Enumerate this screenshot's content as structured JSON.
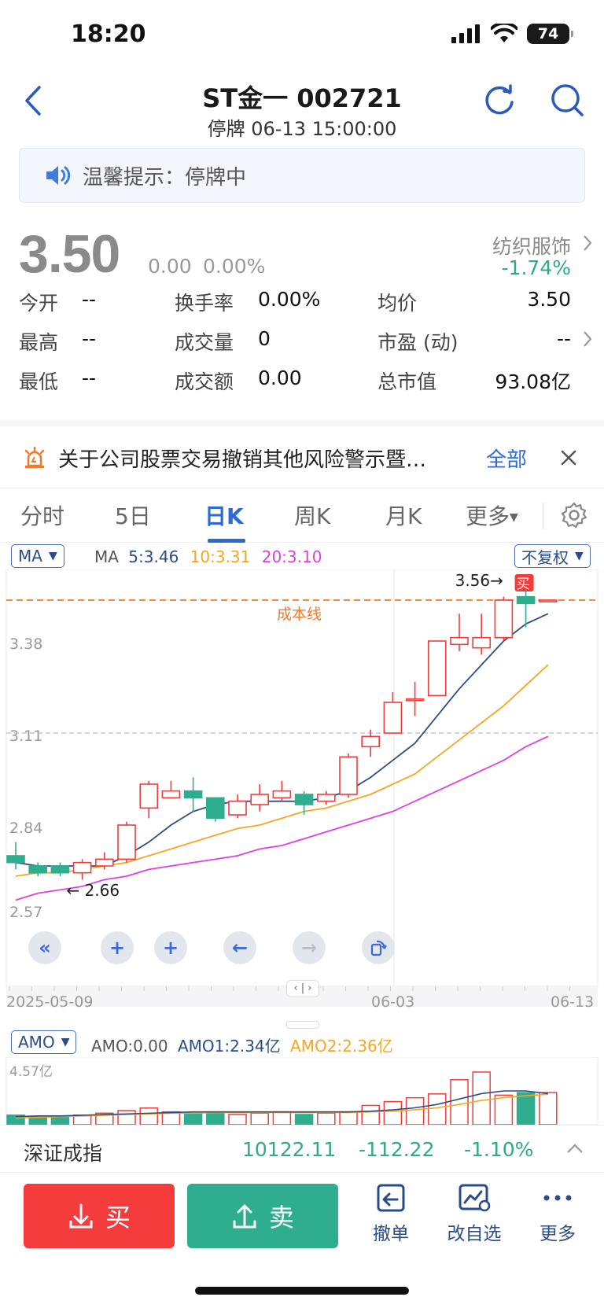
{
  "status_bar": {
    "time": "18:20",
    "battery": "74"
  },
  "header": {
    "title": "ST金一 002721",
    "subtitle": "停牌 06-13 15:00:00"
  },
  "notice": {
    "text": "温馨提示：停牌中"
  },
  "quote": {
    "price": "3.50",
    "change": "0.00",
    "change_pct": "0.00%",
    "sector": "纺织服饰",
    "sector_change": "-1.74%"
  },
  "stats": {
    "open_label": "今开",
    "open": "--",
    "high_label": "最高",
    "high": "--",
    "low_label": "最低",
    "low": "--",
    "turnover_label": "换手率",
    "turnover": "0.00%",
    "volume_label": "成交量",
    "volume": "0",
    "amount_label": "成交额",
    "amount": "0.00",
    "avg_label": "均价",
    "avg": "3.50",
    "pe_label": "市盈 (动)",
    "pe": "--",
    "mcap_label": "总市值",
    "mcap": "93.08亿"
  },
  "announcement": {
    "text": "关于公司股票交易撤销其他风险警示暨…",
    "all": "全部"
  },
  "tabs": [
    "分时",
    "5日",
    "日K",
    "周K",
    "月K",
    "更多"
  ],
  "chart_controls": {
    "ma_dropdown": "MA",
    "ma_title": "MA",
    "ma5": "5:3.46",
    "ma10": "10:3.31",
    "ma20": "20:3.10",
    "adjust_dropdown": "不复权",
    "cost_line": "成本线",
    "buy_marker": "买",
    "high_label": "3.56",
    "low_label": "2.66"
  },
  "colors": {
    "up": "#f23c3c",
    "down": "#2fae8f",
    "ma5": "#2a4d8a",
    "ma10": "#f5a623",
    "ma20": "#e040e0",
    "cost": "#f07a2a",
    "accent": "#2a6bd8"
  },
  "chart_data": {
    "type": "candlestick",
    "y_ticks": [
      "3.65",
      "3.38",
      "3.11",
      "2.84",
      "2.57"
    ],
    "ylim": [
      2.57,
      3.65
    ],
    "x_labels": [
      "2025-05-09",
      "06-03",
      "06-13"
    ],
    "cost_line": 3.5,
    "reference_line": 3.11,
    "candles": [
      {
        "o": 2.75,
        "c": 2.73,
        "h": 2.79,
        "l": 2.71
      },
      {
        "o": 2.72,
        "c": 2.7,
        "h": 2.73,
        "l": 2.69
      },
      {
        "o": 2.72,
        "c": 2.7,
        "h": 2.73,
        "l": 2.69
      },
      {
        "o": 2.7,
        "c": 2.73,
        "h": 2.74,
        "l": 2.68
      },
      {
        "o": 2.72,
        "c": 2.74,
        "h": 2.76,
        "l": 2.71
      },
      {
        "o": 2.74,
        "c": 2.84,
        "h": 2.85,
        "l": 2.73
      },
      {
        "o": 2.89,
        "c": 2.96,
        "h": 2.97,
        "l": 2.86
      },
      {
        "o": 2.92,
        "c": 2.94,
        "h": 2.97,
        "l": 2.92
      },
      {
        "o": 2.94,
        "c": 2.92,
        "h": 2.98,
        "l": 2.88
      },
      {
        "o": 2.92,
        "c": 2.86,
        "h": 2.92,
        "l": 2.85
      },
      {
        "o": 2.87,
        "c": 2.91,
        "h": 2.93,
        "l": 2.86
      },
      {
        "o": 2.9,
        "c": 2.93,
        "h": 2.96,
        "l": 2.88
      },
      {
        "o": 2.92,
        "c": 2.94,
        "h": 2.97,
        "l": 2.91
      },
      {
        "o": 2.93,
        "c": 2.9,
        "h": 2.94,
        "l": 2.87
      },
      {
        "o": 2.91,
        "c": 2.93,
        "h": 2.94,
        "l": 2.9
      },
      {
        "o": 2.93,
        "c": 3.04,
        "h": 3.05,
        "l": 2.92
      },
      {
        "o": 3.07,
        "c": 3.1,
        "h": 3.12,
        "l": 3.04
      },
      {
        "o": 3.11,
        "c": 3.2,
        "h": 3.23,
        "l": 3.11
      },
      {
        "o": 3.21,
        "c": 3.21,
        "h": 3.26,
        "l": 3.16
      },
      {
        "o": 3.22,
        "c": 3.38,
        "h": 3.38,
        "l": 3.22
      },
      {
        "o": 3.37,
        "c": 3.39,
        "h": 3.46,
        "l": 3.35
      },
      {
        "o": 3.36,
        "c": 3.39,
        "h": 3.46,
        "l": 3.34
      },
      {
        "o": 3.39,
        "c": 3.5,
        "h": 3.51,
        "l": 3.38
      },
      {
        "o": 3.51,
        "c": 3.49,
        "h": 3.56,
        "l": 3.42
      },
      {
        "o": 3.5,
        "c": 3.5,
        "h": 3.5,
        "l": 3.5
      }
    ],
    "ma5": [
      2.73,
      2.72,
      2.72,
      2.72,
      2.72,
      2.75,
      2.79,
      2.84,
      2.88,
      2.9,
      2.91,
      2.91,
      2.91,
      2.91,
      2.92,
      2.94,
      2.98,
      3.03,
      3.08,
      3.16,
      3.24,
      3.31,
      3.38,
      3.43,
      3.46
    ],
    "ma10": [
      2.69,
      2.7,
      2.7,
      2.71,
      2.72,
      2.73,
      2.75,
      2.77,
      2.79,
      2.81,
      2.83,
      2.84,
      2.86,
      2.88,
      2.89,
      2.91,
      2.93,
      2.96,
      2.99,
      3.04,
      3.09,
      3.14,
      3.19,
      3.25,
      3.31
    ],
    "ma20": [
      2.62,
      2.64,
      2.65,
      2.66,
      2.68,
      2.69,
      2.71,
      2.72,
      2.73,
      2.74,
      2.75,
      2.77,
      2.78,
      2.8,
      2.82,
      2.84,
      2.86,
      2.88,
      2.91,
      2.94,
      2.97,
      3.0,
      3.03,
      3.07,
      3.1
    ]
  },
  "amo": {
    "dropdown": "AMO",
    "amo": "AMO:0.00",
    "amo1": "AMO1:2.34亿",
    "amo2": "AMO2:2.36亿",
    "max": "4.57亿"
  },
  "index_bar": {
    "name": "深证成指",
    "value": "10122.11",
    "change": "-112.22",
    "pct": "-1.10%"
  },
  "trade": {
    "buy": "买",
    "sell": "卖",
    "cancel": "撤单",
    "watchlist": "改自选",
    "more": "更多"
  }
}
